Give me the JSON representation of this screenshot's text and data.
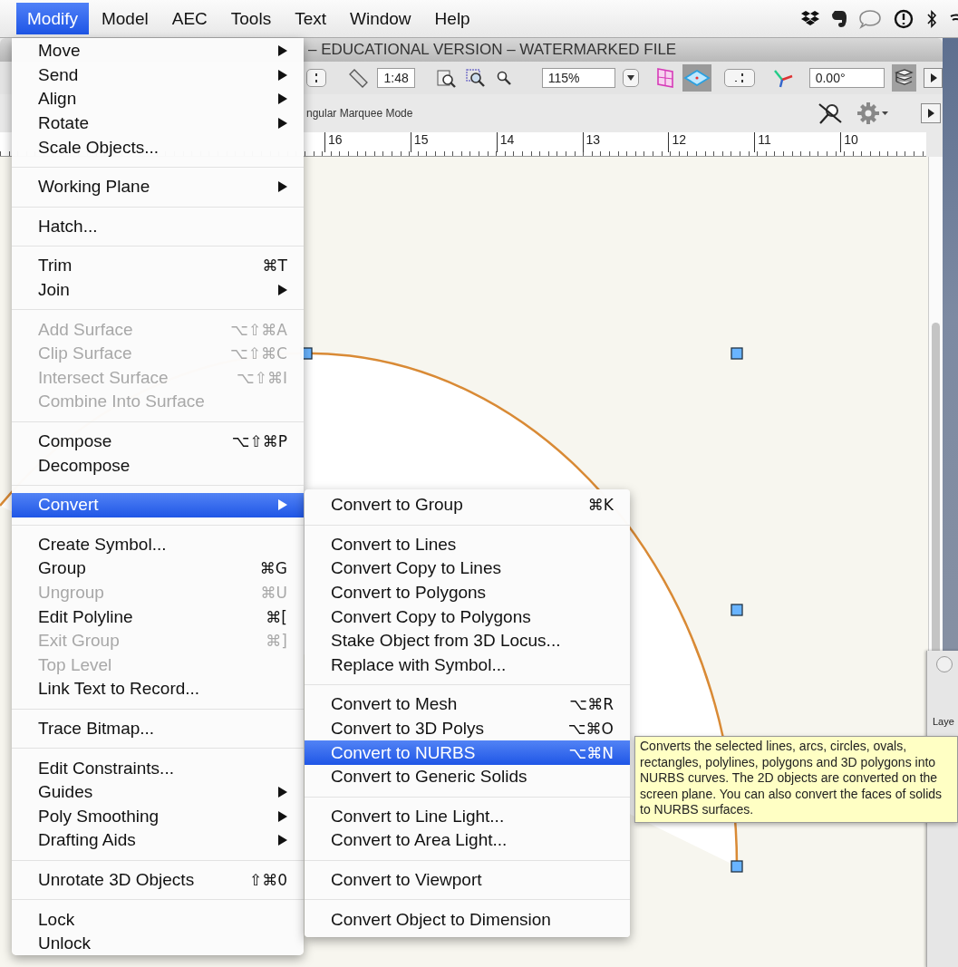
{
  "menu_bar": [
    {
      "label": "Modify",
      "selected": true
    },
    {
      "label": "Model",
      "selected": false
    },
    {
      "label": "AEC",
      "selected": false
    },
    {
      "label": "Tools",
      "selected": false
    },
    {
      "label": "Text",
      "selected": false
    },
    {
      "label": "Window",
      "selected": false
    },
    {
      "label": "Help",
      "selected": false
    }
  ],
  "window": {
    "title": "– EDUCATIONAL VERSION – WATERMARKED FILE"
  },
  "toolbar": {
    "scale": "1:48",
    "zoom": "115%",
    "angle": "0.00°"
  },
  "mode_bar": {
    "mode": "ngular Marquee Mode"
  },
  "ruler": [
    "16",
    "15",
    "14",
    "13",
    "12",
    "11",
    "10"
  ],
  "modify_menu": [
    {
      "kind": "item",
      "label": "Move",
      "submenu": true,
      "disabled": false,
      "selected": false
    },
    {
      "kind": "item",
      "label": "Send",
      "submenu": true,
      "disabled": false,
      "selected": false
    },
    {
      "kind": "item",
      "label": "Align",
      "submenu": true,
      "disabled": false,
      "selected": false
    },
    {
      "kind": "item",
      "label": "Rotate",
      "submenu": true,
      "disabled": false,
      "selected": false
    },
    {
      "kind": "item",
      "label": "Scale Objects...",
      "disabled": false,
      "selected": false
    },
    {
      "kind": "separator"
    },
    {
      "kind": "item",
      "label": "Working Plane",
      "submenu": true,
      "disabled": false,
      "selected": false
    },
    {
      "kind": "separator"
    },
    {
      "kind": "item",
      "label": "Hatch...",
      "disabled": false,
      "selected": false
    },
    {
      "kind": "separator"
    },
    {
      "kind": "item",
      "label": "Trim",
      "shortcut": "⌘T",
      "disabled": false,
      "selected": false
    },
    {
      "kind": "item",
      "label": "Join",
      "submenu": true,
      "disabled": false,
      "selected": false
    },
    {
      "kind": "separator"
    },
    {
      "kind": "item",
      "label": "Add Surface",
      "shortcut": "⌥⇧⌘A",
      "disabled": true,
      "selected": false
    },
    {
      "kind": "item",
      "label": "Clip Surface",
      "shortcut": "⌥⇧⌘C",
      "disabled": true,
      "selected": false
    },
    {
      "kind": "item",
      "label": "Intersect Surface",
      "shortcut": "⌥⇧⌘I",
      "disabled": true,
      "selected": false
    },
    {
      "kind": "item",
      "label": "Combine Into Surface",
      "disabled": true,
      "selected": false
    },
    {
      "kind": "separator"
    },
    {
      "kind": "item",
      "label": "Compose",
      "shortcut": "⌥⇧⌘P",
      "disabled": false,
      "selected": false
    },
    {
      "kind": "item",
      "label": "Decompose",
      "disabled": false,
      "selected": false
    },
    {
      "kind": "separator"
    },
    {
      "kind": "item",
      "label": "Convert",
      "submenu": true,
      "disabled": false,
      "selected": true
    },
    {
      "kind": "separator"
    },
    {
      "kind": "item",
      "label": "Create Symbol...",
      "disabled": false,
      "selected": false
    },
    {
      "kind": "item",
      "label": "Group",
      "shortcut": "⌘G",
      "disabled": false,
      "selected": false
    },
    {
      "kind": "item",
      "label": "Ungroup",
      "shortcut": "⌘U",
      "disabled": true,
      "selected": false
    },
    {
      "kind": "item",
      "label": "Edit Polyline",
      "shortcut": "⌘[",
      "disabled": false,
      "selected": false
    },
    {
      "kind": "item",
      "label": "Exit Group",
      "shortcut": "⌘]",
      "disabled": true,
      "selected": false
    },
    {
      "kind": "item",
      "label": "Top Level",
      "disabled": true,
      "selected": false
    },
    {
      "kind": "item",
      "label": "Link Text to Record...",
      "disabled": false,
      "selected": false
    },
    {
      "kind": "separator"
    },
    {
      "kind": "item",
      "label": "Trace Bitmap...",
      "disabled": false,
      "selected": false
    },
    {
      "kind": "separator"
    },
    {
      "kind": "item",
      "label": "Edit Constraints...",
      "disabled": false,
      "selected": false
    },
    {
      "kind": "item",
      "label": "Guides",
      "submenu": true,
      "disabled": false,
      "selected": false
    },
    {
      "kind": "item",
      "label": "Poly Smoothing",
      "submenu": true,
      "disabled": false,
      "selected": false
    },
    {
      "kind": "item",
      "label": "Drafting Aids",
      "submenu": true,
      "disabled": false,
      "selected": false
    },
    {
      "kind": "separator"
    },
    {
      "kind": "item",
      "label": "Unrotate 3D Objects",
      "shortcut": "⇧⌘0",
      "disabled": false,
      "selected": false
    },
    {
      "kind": "separator"
    },
    {
      "kind": "item",
      "label": "Lock",
      "disabled": false,
      "selected": false
    },
    {
      "kind": "item",
      "label": "Unlock",
      "disabled": false,
      "selected": false
    }
  ],
  "convert_submenu": [
    {
      "kind": "item",
      "label": "Convert to Group",
      "shortcut": "⌘K",
      "disabled": false,
      "selected": false
    },
    {
      "kind": "separator"
    },
    {
      "kind": "item",
      "label": "Convert to Lines",
      "disabled": false,
      "selected": false
    },
    {
      "kind": "item",
      "label": "Convert Copy to Lines",
      "disabled": false,
      "selected": false
    },
    {
      "kind": "item",
      "label": "Convert to Polygons",
      "disabled": false,
      "selected": false
    },
    {
      "kind": "item",
      "label": "Convert Copy to Polygons",
      "disabled": false,
      "selected": false
    },
    {
      "kind": "item",
      "label": "Stake Object from 3D Locus...",
      "disabled": false,
      "selected": false
    },
    {
      "kind": "item",
      "label": "Replace with Symbol...",
      "disabled": false,
      "selected": false
    },
    {
      "kind": "separator"
    },
    {
      "kind": "item",
      "label": "Convert to Mesh",
      "shortcut": "⌥⌘R",
      "disabled": false,
      "selected": false
    },
    {
      "kind": "item",
      "label": "Convert to 3D Polys",
      "shortcut": "⌥⌘O",
      "disabled": false,
      "selected": false
    },
    {
      "kind": "item",
      "label": "Convert to NURBS",
      "shortcut": "⌥⌘N",
      "disabled": false,
      "selected": true
    },
    {
      "kind": "item",
      "label": "Convert to Generic Solids",
      "disabled": false,
      "selected": false
    },
    {
      "kind": "separator"
    },
    {
      "kind": "item",
      "label": "Convert to Line Light...",
      "disabled": false,
      "selected": false
    },
    {
      "kind": "item",
      "label": "Convert to Area Light...",
      "disabled": false,
      "selected": false
    },
    {
      "kind": "separator"
    },
    {
      "kind": "item",
      "label": "Convert to Viewport",
      "disabled": false,
      "selected": false
    },
    {
      "kind": "separator"
    },
    {
      "kind": "item",
      "label": "Convert Object to Dimension",
      "disabled": false,
      "selected": false
    }
  ],
  "tooltip": {
    "text": "Converts the selected lines, arcs, circles, ovals, rectangles, polylines, polygons and 3D polygons into NURBS curves. The 2D objects are converted on the screen plane. You can also convert the faces of solids to NURBS surfaces."
  },
  "palette": {
    "tab": "Laye"
  }
}
